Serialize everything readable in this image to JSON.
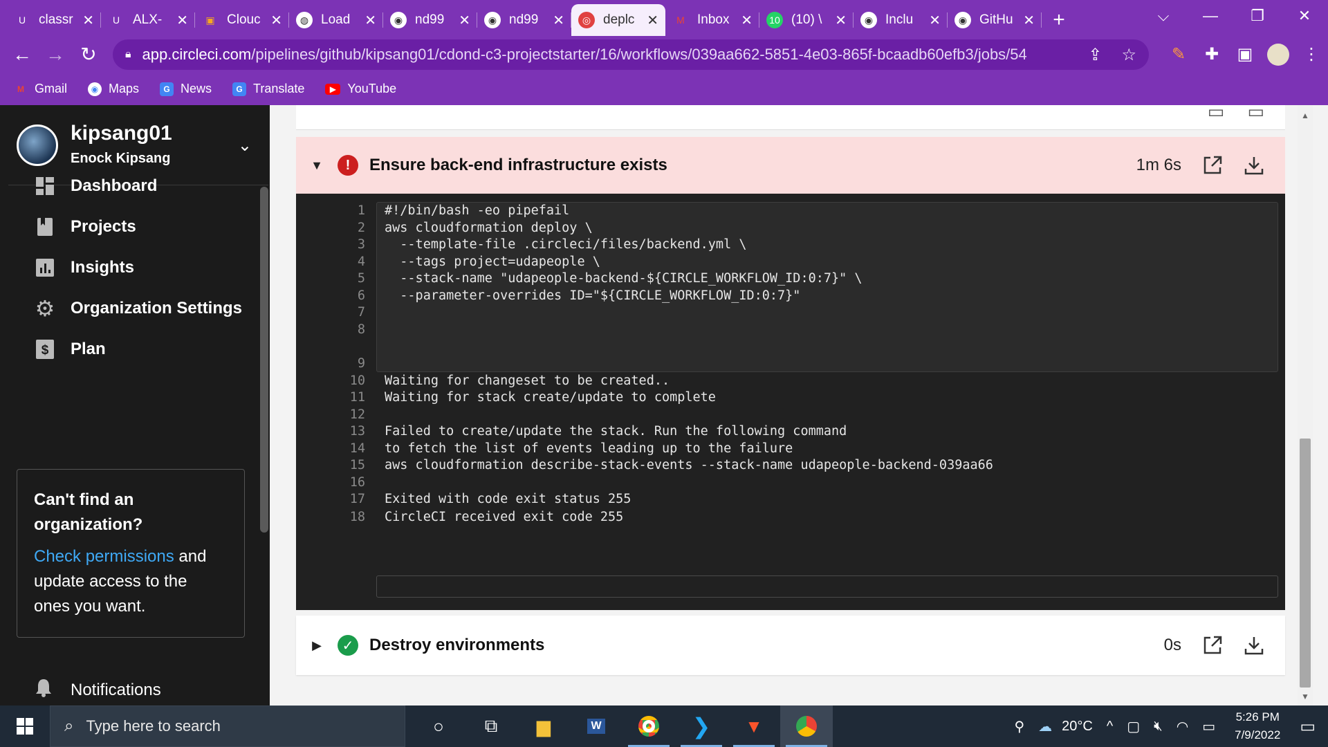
{
  "browser": {
    "tabs": [
      {
        "label": "classr",
        "icon": "udacity-icon",
        "active": false
      },
      {
        "label": "ALX-",
        "icon": "udacity-icon",
        "active": false
      },
      {
        "label": "Clouc",
        "icon": "aws-box-icon",
        "active": false
      },
      {
        "label": "Load",
        "icon": "globe-icon",
        "active": false
      },
      {
        "label": "nd99",
        "icon": "github-icon",
        "active": false
      },
      {
        "label": "nd99",
        "icon": "github-icon",
        "active": false
      },
      {
        "label": "deplc",
        "icon": "circleci-icon",
        "active": true
      },
      {
        "label": "Inbox",
        "icon": "gmail-icon",
        "active": false
      },
      {
        "label": "(10) \\",
        "icon": "whatsapp-icon",
        "active": false
      },
      {
        "label": "Inclu",
        "icon": "github-icon",
        "active": false
      },
      {
        "label": "GitHu",
        "icon": "github-icon",
        "active": false
      }
    ],
    "url_host": "app.circleci.com",
    "url_path": "/pipelines/github/kipsang01/cdond-c3-projectstarter/16/workflows/039aa662-5851-4e03-865f-bcaadb60efb3/jobs/54",
    "bookmarks": [
      "Gmail",
      "Maps",
      "News",
      "Translate",
      "YouTube"
    ]
  },
  "sidebar": {
    "username": "kipsang01",
    "fullname": "Enock Kipsang",
    "nav": [
      {
        "label": "Dashboard",
        "icon": "dashboard-icon"
      },
      {
        "label": "Projects",
        "icon": "bookmark-icon"
      },
      {
        "label": "Insights",
        "icon": "bar-chart-icon"
      },
      {
        "label": "Organization Settings",
        "icon": "gear-icon"
      },
      {
        "label": "Plan",
        "icon": "dollar-icon"
      }
    ],
    "callout": {
      "title": "Can't find an organization?",
      "link": "Check permissions",
      "body": " and update access to the ones you want."
    },
    "notifications": "Notifications"
  },
  "job": {
    "failed_step": {
      "title": "Ensure back-end infrastructure exists",
      "duration": "1m 6s",
      "status": "failed"
    },
    "console": [
      {
        "n": "1",
        "t": "#!/bin/bash -eo pipefail"
      },
      {
        "n": "2",
        "t": "aws cloudformation deploy \\"
      },
      {
        "n": "3",
        "t": "  --template-file .circleci/files/backend.yml \\"
      },
      {
        "n": "4",
        "t": "  --tags project=udapeople \\"
      },
      {
        "n": "5",
        "t": "  --stack-name \"udapeople-backend-${CIRCLE_WORKFLOW_ID:0:7}\" \\"
      },
      {
        "n": "6",
        "t": "  --parameter-overrides ID=\"${CIRCLE_WORKFLOW_ID:0:7}\""
      },
      {
        "n": "7",
        "t": ""
      },
      {
        "n": "8",
        "t": ""
      },
      {
        "n": "9",
        "t": ""
      },
      {
        "n": "10",
        "t": "Waiting for changeset to be created.."
      },
      {
        "n": "11",
        "t": "Waiting for stack create/update to complete"
      },
      {
        "n": "12",
        "t": ""
      },
      {
        "n": "13",
        "t": "Failed to create/update the stack. Run the following command"
      },
      {
        "n": "14",
        "t": "to fetch the list of events leading up to the failure"
      },
      {
        "n": "15",
        "t": "aws cloudformation describe-stack-events --stack-name udapeople-backend-039aa66"
      },
      {
        "n": "16",
        "t": ""
      },
      {
        "n": "17",
        "t": "Exited with code exit status 255"
      },
      {
        "n": "18",
        "t": "CircleCI received exit code 255"
      }
    ],
    "next_step": {
      "title": "Destroy environments",
      "duration": "0s",
      "status": "success"
    }
  },
  "taskbar": {
    "search_placeholder": "Type here to search",
    "weather": "20°C",
    "time": "5:26 PM",
    "date": "7/9/2022"
  },
  "colors": {
    "chrome_purple": "#7c33b5",
    "sidebar_bg": "#1b1b1b",
    "fail_bg": "#fbdddd",
    "error_red": "#cc1f1f",
    "success_green": "#1a9c4b",
    "link_blue": "#3fa9f5",
    "console_bg": "#212121"
  }
}
